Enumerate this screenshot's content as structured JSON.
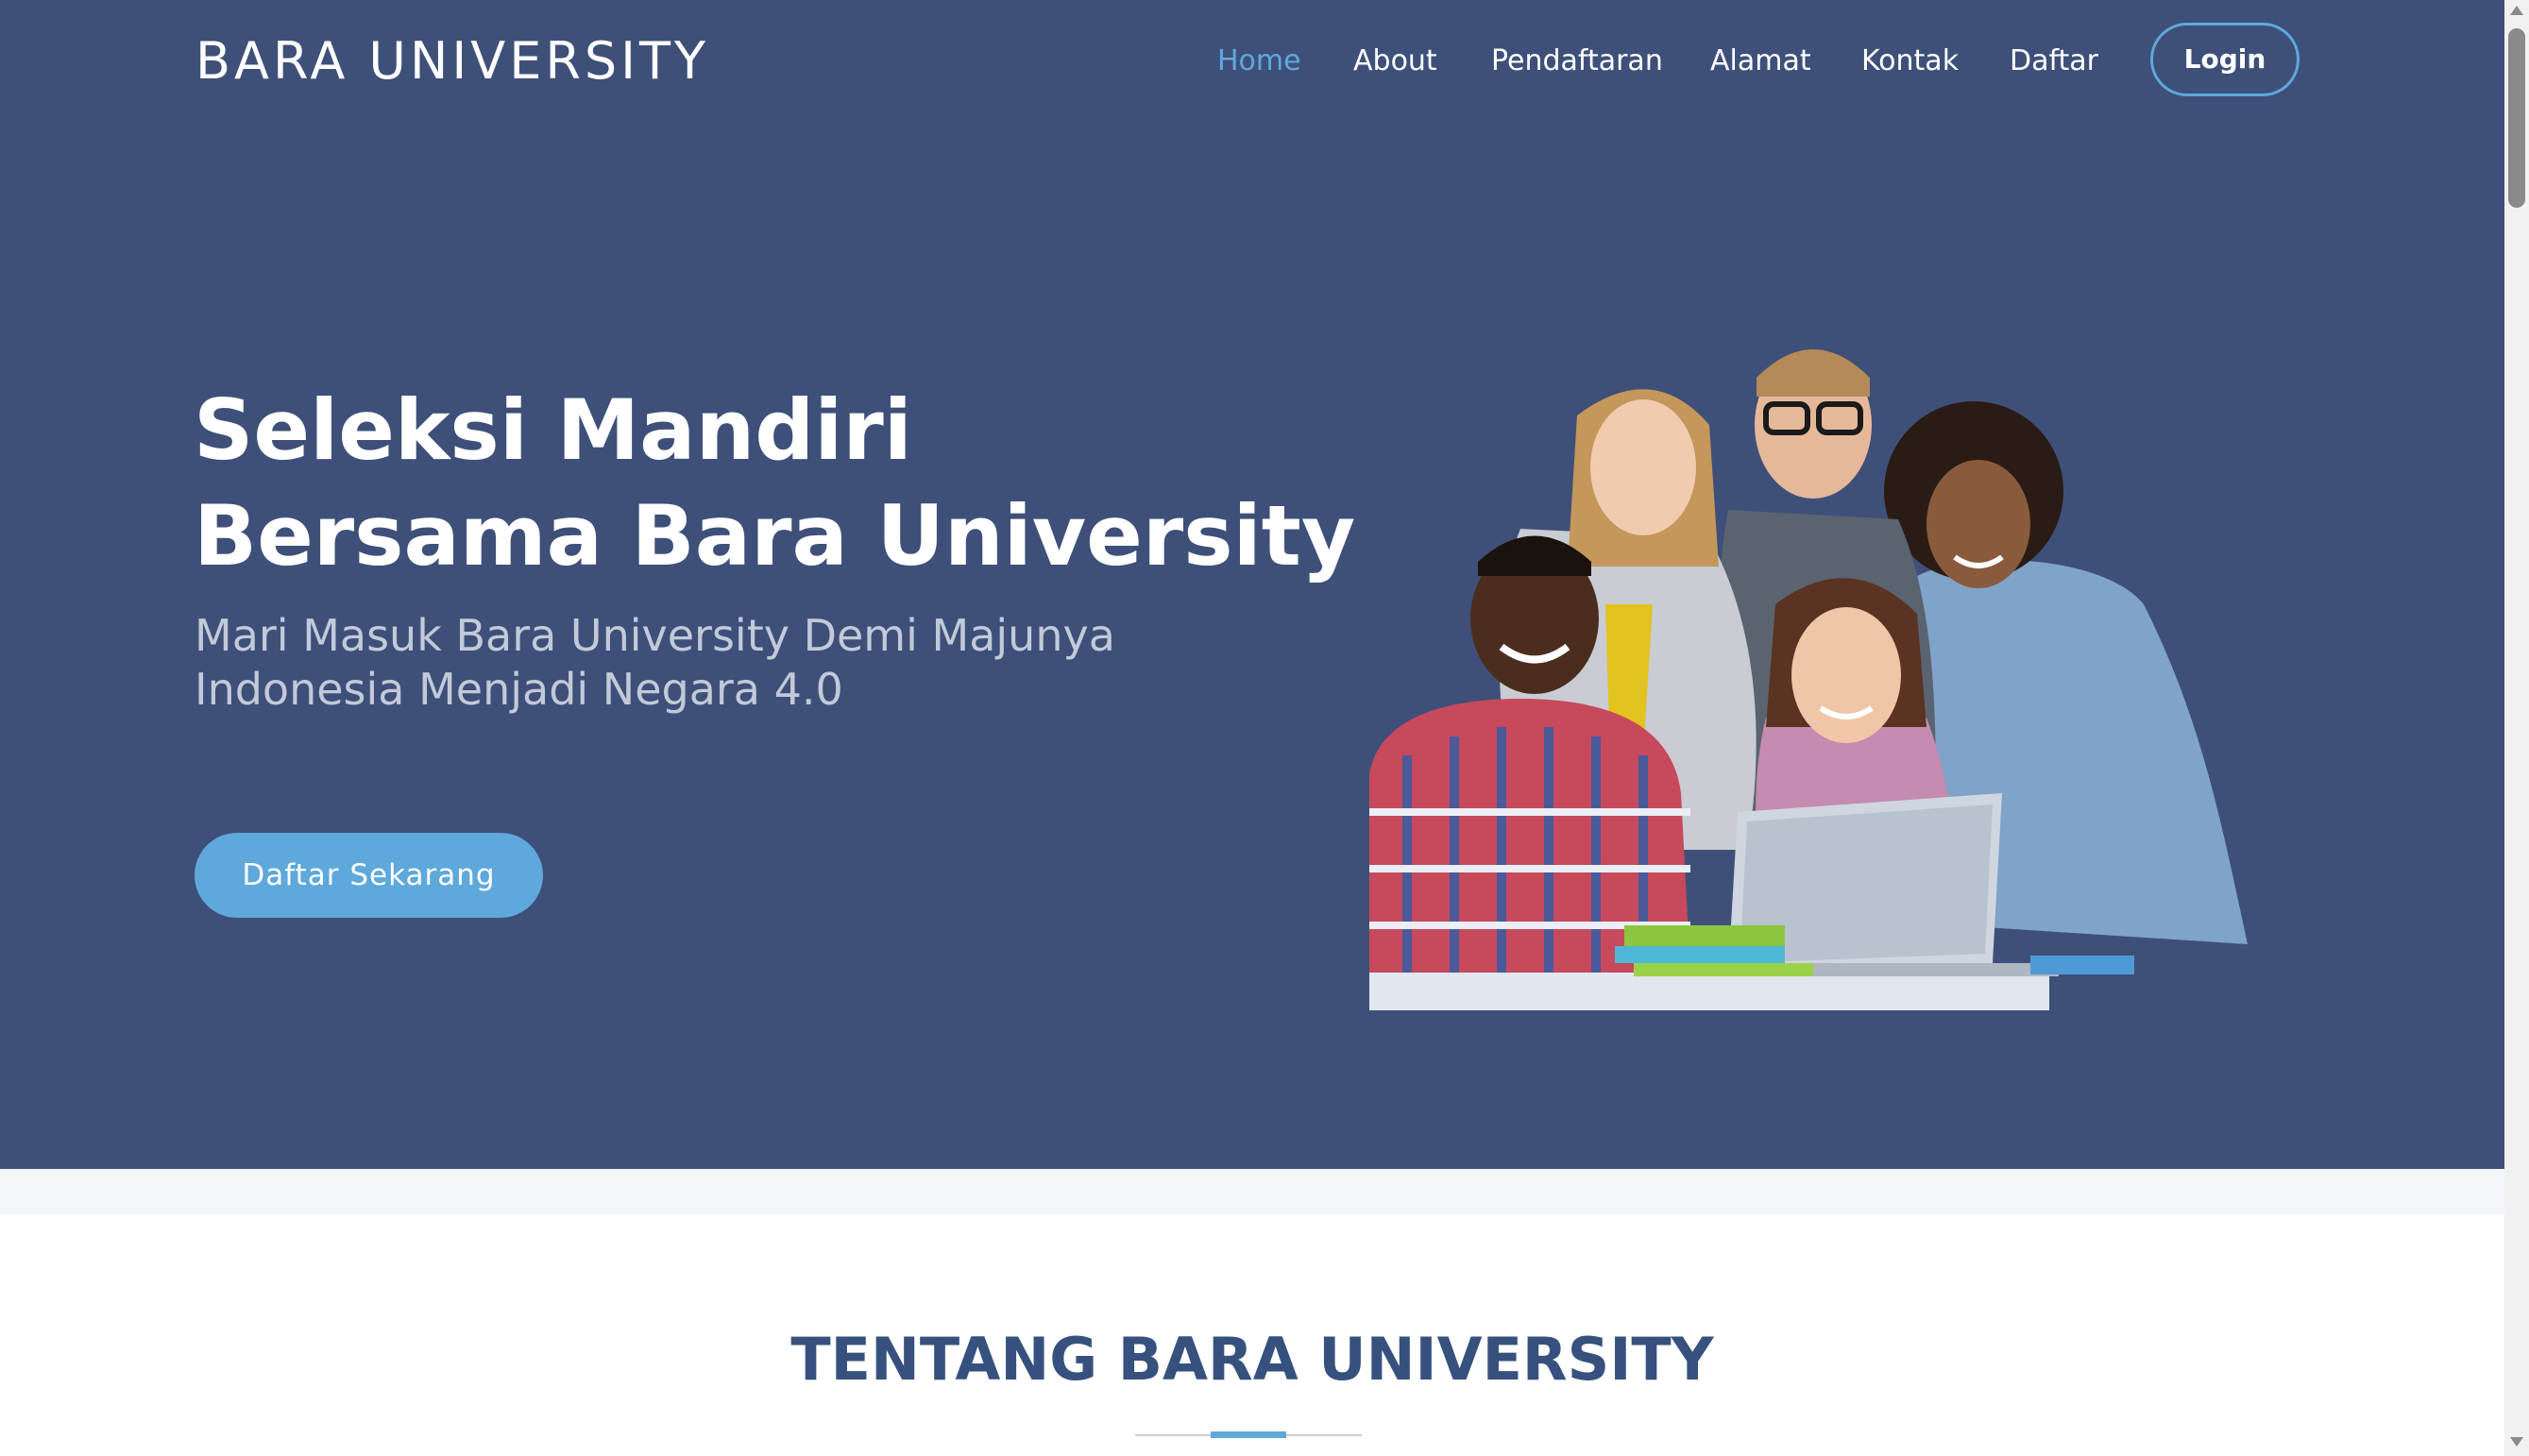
{
  "brand": {
    "logo_text": "BARA UNIVERSITY"
  },
  "nav": {
    "items": [
      {
        "label": "Home",
        "active": true
      },
      {
        "label": "About",
        "active": false
      },
      {
        "label": "Pendaftaran",
        "active": false
      },
      {
        "label": "Alamat",
        "active": false
      },
      {
        "label": "Kontak",
        "active": false
      },
      {
        "label": "Daftar",
        "active": false
      }
    ],
    "login_label": "Login"
  },
  "hero": {
    "title_line1": "Seleksi Mandiri",
    "title_line2": "Bersama Bara University",
    "subtitle_line1": "Mari Masuk Bara University Demi Majunya",
    "subtitle_line2": "Indonesia Menjadi Negara 4.0",
    "cta_label": "Daftar Sekarang",
    "image_subject": "group-of-students-with-laptop"
  },
  "about": {
    "section_title": "TENTANG BARA UNIVERSITY"
  },
  "colors": {
    "hero_bg": "#3e5079",
    "accent": "#5ea8dc",
    "heading": "#37517e",
    "subtitle": "#c2c9d8",
    "strip_bg": "#f3f5f9"
  }
}
